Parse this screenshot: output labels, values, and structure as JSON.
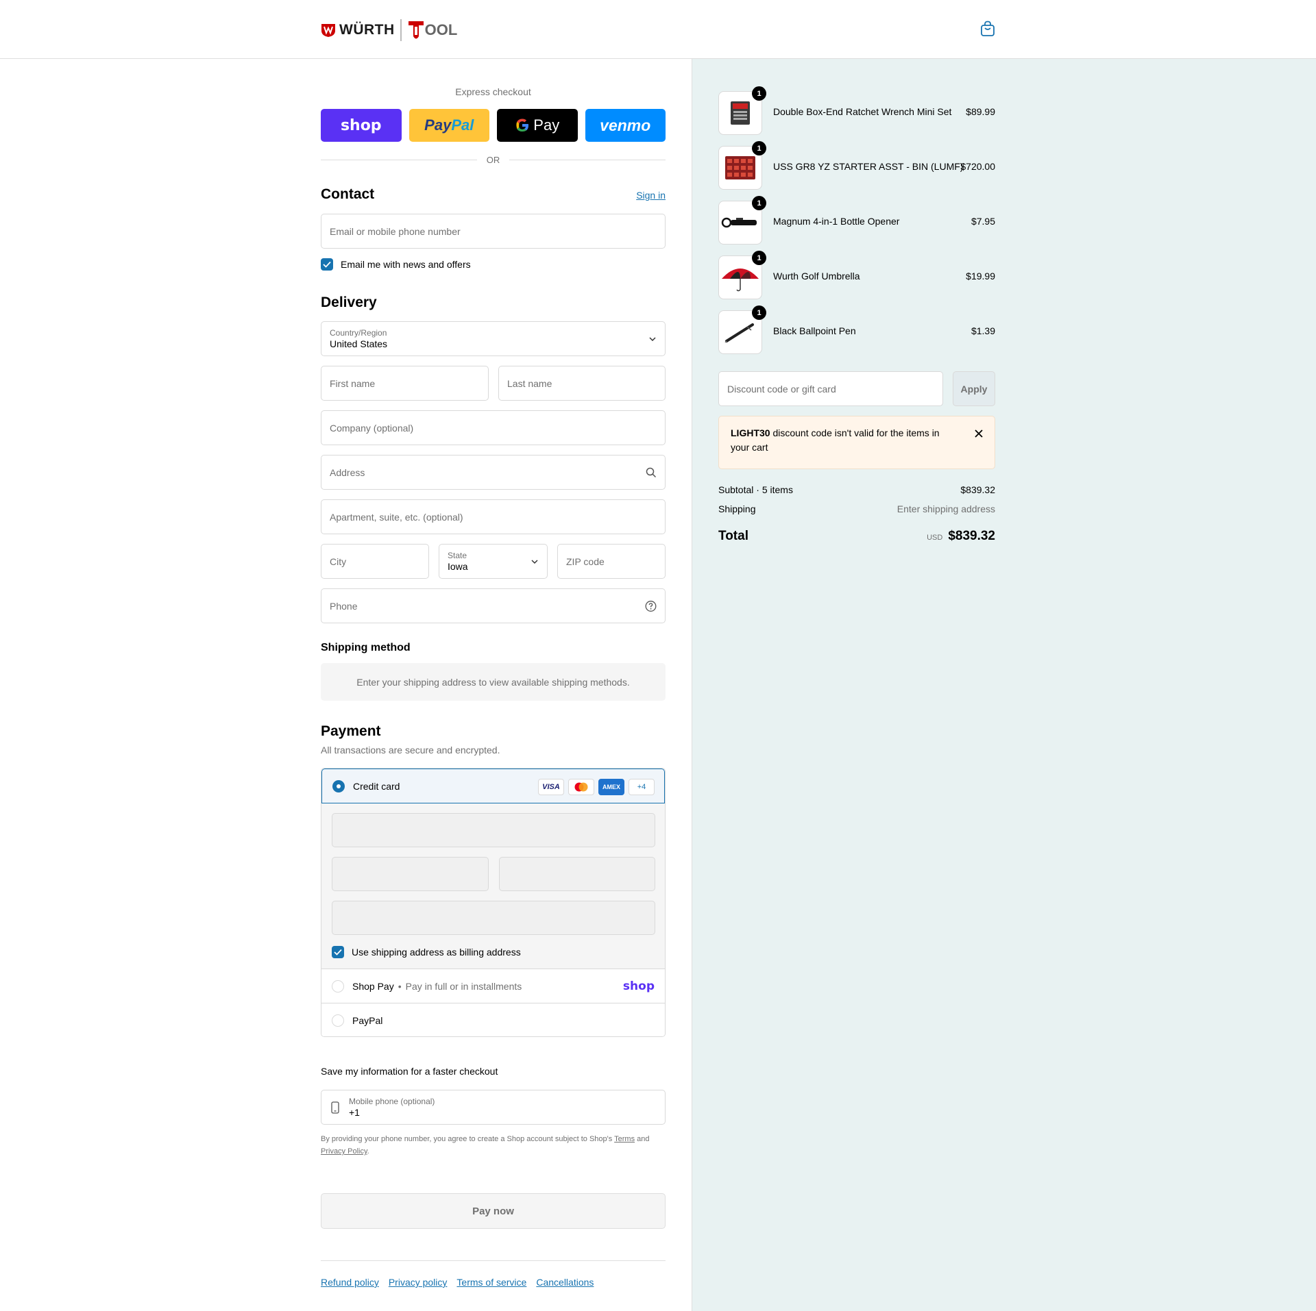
{
  "header": {
    "brand_left": "WÜRTH",
    "brand_right": "OOL"
  },
  "express": {
    "label": "Express checkout",
    "shop": "shop",
    "paypal_1": "Pay",
    "paypal_2": "Pal",
    "gpay": "Pay",
    "venmo": "venmo",
    "or": "OR"
  },
  "contact": {
    "title": "Contact",
    "sign_in": "Sign in",
    "email_placeholder": "Email or mobile phone number",
    "news_label": "Email me with news and offers"
  },
  "delivery": {
    "title": "Delivery",
    "country_label": "Country/Region",
    "country_value": "United States",
    "first_name": "First name",
    "last_name": "Last name",
    "company": "Company (optional)",
    "address": "Address",
    "apartment": "Apartment, suite, etc. (optional)",
    "city": "City",
    "state_label": "State",
    "state_value": "Iowa",
    "zip": "ZIP code",
    "phone": "Phone"
  },
  "shipping": {
    "title": "Shipping method",
    "message": "Enter your shipping address to view available shipping methods."
  },
  "payment": {
    "title": "Payment",
    "subtitle": "All transactions are secure and encrypted.",
    "credit_card": "Credit card",
    "card_visa": "VISA",
    "card_amex": "AMEX",
    "card_more": "+4",
    "billing_label": "Use shipping address as billing address",
    "shop_pay": "Shop Pay",
    "shop_pay_sub": "Pay in full or in installments",
    "shop_logo": "shop",
    "paypal": "PayPal"
  },
  "save_info": {
    "title": "Save my information for a faster checkout",
    "mobile_label": "Mobile phone (optional)",
    "mobile_value": "+1",
    "legal_1": "By providing your phone number, you agree to create a Shop account subject to Shop's",
    "legal_terms": "Terms",
    "legal_and": "and",
    "legal_privacy": "Privacy Policy",
    "legal_end": "."
  },
  "pay_now": "Pay now",
  "footer_links": [
    "Refund policy",
    "Privacy policy",
    "Terms of service",
    "Cancellations"
  ],
  "cart": {
    "items": [
      {
        "name": "Double Box-End Ratchet Wrench Mini Set",
        "price": "$89.99",
        "qty": "1"
      },
      {
        "name": "USS GR8 YZ STARTER ASST - BIN (LUMF)",
        "price": "$720.00",
        "qty": "1"
      },
      {
        "name": "Magnum 4-in-1 Bottle Opener",
        "price": "$7.95",
        "qty": "1"
      },
      {
        "name": "Wurth Golf Umbrella",
        "price": "$19.99",
        "qty": "1"
      },
      {
        "name": "Black Ballpoint Pen",
        "price": "$1.39",
        "qty": "1"
      }
    ],
    "discount_placeholder": "Discount code or gift card",
    "apply": "Apply",
    "warning_code": "LIGHT30",
    "warning_text": " discount code isn't valid for the items in your cart",
    "subtotal_label": "Subtotal · 5 items",
    "subtotal_value": "$839.32",
    "shipping_label": "Shipping",
    "shipping_value": "Enter shipping address",
    "total_label": "Total",
    "currency": "USD",
    "total_value": "$839.32"
  },
  "colors": {
    "accent": "#1773b0",
    "summary_bg": "#e8f2f2",
    "shop_purple": "#5a31f4",
    "paypal_yellow": "#ffc439",
    "venmo_blue": "#008cff",
    "warning_bg": "#fff5ea"
  }
}
